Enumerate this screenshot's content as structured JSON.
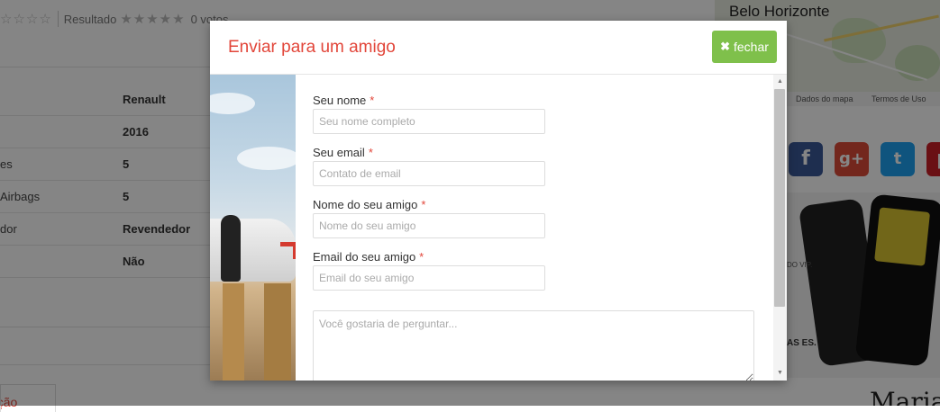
{
  "background": {
    "rating_label": "Resultado",
    "rating_votes": "0 votos",
    "spec_rows": [
      {
        "key": "",
        "value": "Renault"
      },
      {
        "key": "",
        "value": "2016"
      },
      {
        "key": "es",
        "value": "5"
      },
      {
        "key": "Airbags",
        "value": "5"
      },
      {
        "key": "dor",
        "value": "Revendedor"
      },
      {
        "key": "",
        "value": "Não"
      }
    ],
    "description_tab": "rição",
    "map": {
      "city": "Belo Horizonte",
      "footer_data": "Dados do mapa",
      "footer_terms": "Termos de Uso"
    },
    "social_icons": [
      "facebook-icon",
      "google-plus-icon",
      "twitter-icon",
      "pinterest-icon"
    ],
    "ad_text": "DO VIP.",
    "ad_text2": "AS ES.",
    "ad2_text": "Maria"
  },
  "modal": {
    "title": "Enviar para um amigo",
    "close_label": "fechar",
    "fields": [
      {
        "label": "Seu nome",
        "placeholder": "Seu nome completo",
        "required": "*"
      },
      {
        "label": "Seu email",
        "placeholder": "Contato de email",
        "required": "*"
      },
      {
        "label": "Nome do seu amigo",
        "placeholder": "Nome do seu amigo",
        "required": "*"
      },
      {
        "label": "Email do seu amigo",
        "placeholder": "Email do seu amigo",
        "required": "*"
      }
    ],
    "message_placeholder": "Você gostaria de perguntar..."
  },
  "colors": {
    "accent_red": "#e2463a",
    "close_green": "#7fc04b"
  }
}
